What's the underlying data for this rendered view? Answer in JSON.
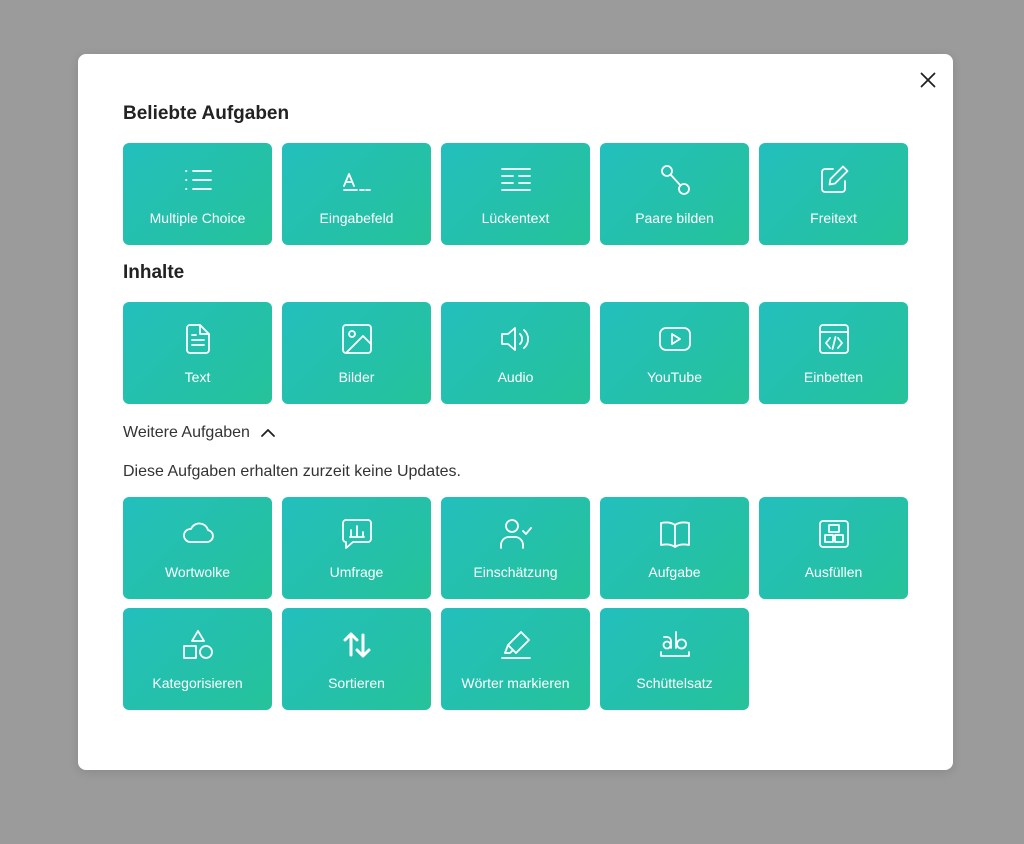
{
  "modal": {
    "close_label": "Close"
  },
  "popular": {
    "title": "Beliebte Aufgaben",
    "tiles": [
      {
        "label": "Multiple Choice",
        "icon": "list-icon"
      },
      {
        "label": "Eingabefeld",
        "icon": "text-input-icon"
      },
      {
        "label": "Lückentext",
        "icon": "gap-text-icon"
      },
      {
        "label": "Paare bilden",
        "icon": "pairs-icon"
      },
      {
        "label": "Freitext",
        "icon": "edit-icon"
      }
    ]
  },
  "content": {
    "title": "Inhalte",
    "tiles": [
      {
        "label": "Text",
        "icon": "document-icon"
      },
      {
        "label": "Bilder",
        "icon": "image-icon"
      },
      {
        "label": "Audio",
        "icon": "speaker-icon"
      },
      {
        "label": "YouTube",
        "icon": "youtube-icon"
      },
      {
        "label": "Einbetten",
        "icon": "embed-icon"
      }
    ]
  },
  "more": {
    "toggle_label": "Weitere Aufgaben",
    "note": "Diese Aufgaben erhalten zurzeit keine Updates.",
    "tiles": [
      {
        "label": "Wortwolke",
        "icon": "cloud-icon"
      },
      {
        "label": "Umfrage",
        "icon": "poll-icon"
      },
      {
        "label": "Einschätzung",
        "icon": "user-check-icon"
      },
      {
        "label": "Aufgabe",
        "icon": "book-icon"
      },
      {
        "label": "Ausfüllen",
        "icon": "layout-icon"
      },
      {
        "label": "Kategorisieren",
        "icon": "shapes-icon"
      },
      {
        "label": "Sortieren",
        "icon": "sort-arrows-icon"
      },
      {
        "label": "Wörter markieren",
        "icon": "highlighter-icon"
      },
      {
        "label": "Schüttelsatz",
        "icon": "ab-text-icon"
      }
    ]
  },
  "colors": {
    "tile_start": "#23bfbd",
    "tile_end": "#25c29a",
    "backdrop": "#9b9b9b",
    "modal": "#ffffff"
  }
}
